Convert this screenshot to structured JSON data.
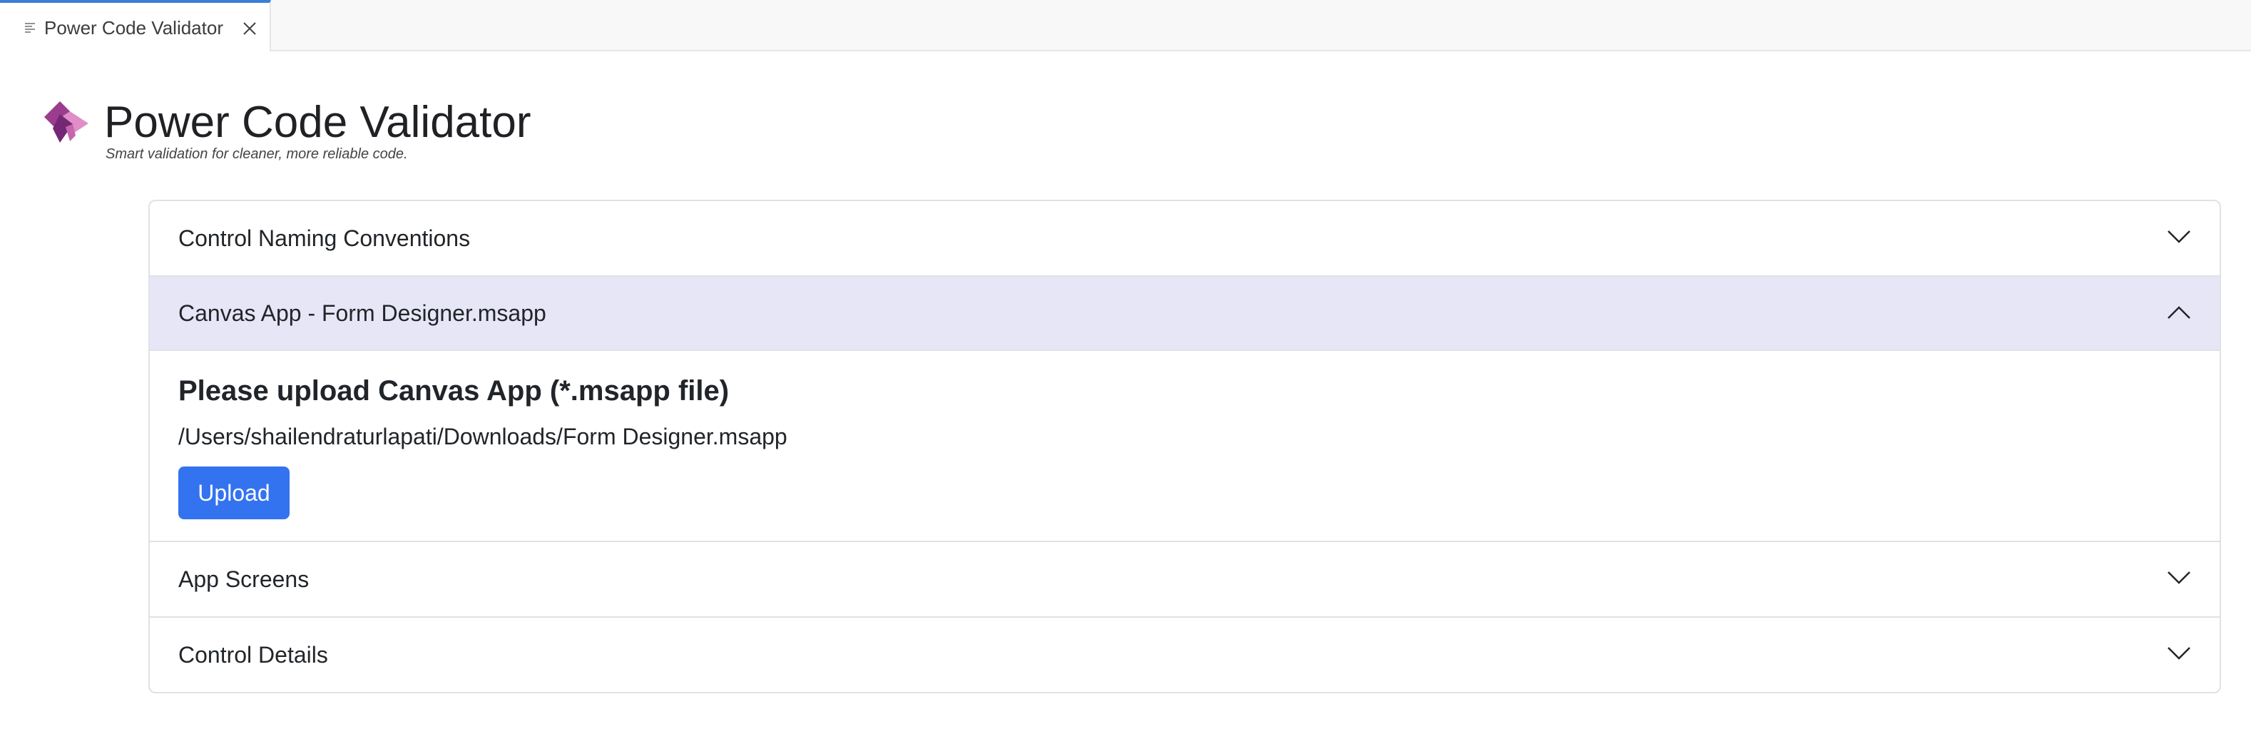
{
  "tab": {
    "title": "Power Code Validator",
    "icon": "document-lines-icon",
    "close_icon": "close-icon"
  },
  "header": {
    "logo_icon": "power-apps-logo",
    "title": "Power Code Validator",
    "subtitle": "Smart validation for cleaner, more reliable code."
  },
  "accordion": {
    "items": [
      {
        "label": "Control Naming Conventions",
        "expanded": false
      },
      {
        "label": "Canvas App - Form Designer.msapp",
        "expanded": true
      },
      {
        "label": "App Screens",
        "expanded": false
      },
      {
        "label": "Control Details",
        "expanded": false
      }
    ],
    "upload": {
      "heading": "Please upload Canvas App (*.msapp file)",
      "file_path": "/Users/shailendraturlapati/Downloads/Form Designer.msapp",
      "button_label": "Upload"
    }
  },
  "colors": {
    "accent_tab": "#3a7fd5",
    "active_header_bg": "#e7e6f7",
    "button_bg": "#3373f0",
    "logo_dark": "#742774",
    "logo_light": "#e08dc8"
  }
}
